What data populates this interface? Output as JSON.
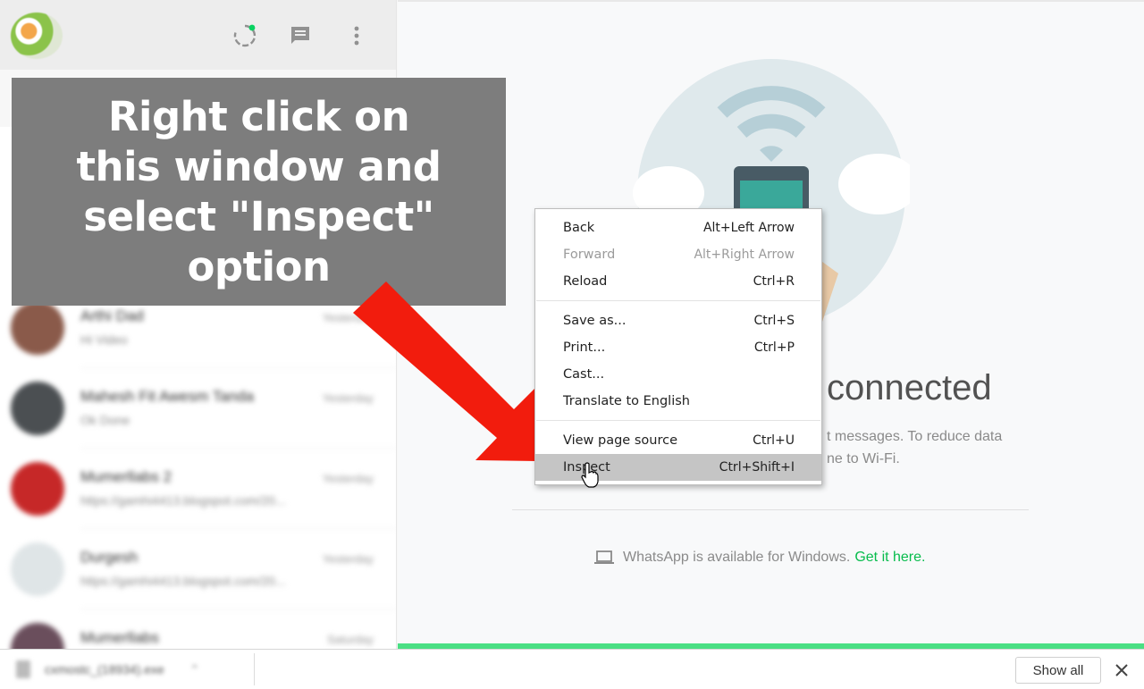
{
  "caption": {
    "line1": "Right click on",
    "line2": "this window and",
    "line3": "select \"Inspect\" option"
  },
  "sidebar": {
    "chats": [
      {
        "name": "Arthi Dad",
        "time": "Yesterday",
        "preview": "Hi Video"
      },
      {
        "name": "Mahesh Fit Awesm Tanda",
        "time": "Yesterday",
        "preview": "Ok Done"
      },
      {
        "name": "Mumerllabs 2",
        "time": "Yesterday",
        "preview": "https://gamhi4413.blogspot.com/20..."
      },
      {
        "name": "Durgesh",
        "time": "Yesterday",
        "preview": "https://gamhi4413.blogspot.com/20..."
      },
      {
        "name": "Mumerllabs",
        "time": "Saturday",
        "preview": ""
      }
    ]
  },
  "main": {
    "heading": "connected",
    "desc1": "t messages. To reduce data",
    "desc2": "ne to Wi-Fi.",
    "windows_text": "WhatsApp is available for Windows.",
    "windows_link": "Get it here."
  },
  "context_menu": {
    "items": [
      {
        "label": "Back",
        "shortcut": "Alt+Left Arrow",
        "disabled": false
      },
      {
        "label": "Forward",
        "shortcut": "Alt+Right Arrow",
        "disabled": true
      },
      {
        "label": "Reload",
        "shortcut": "Ctrl+R",
        "disabled": false
      },
      {
        "label": "Save as...",
        "shortcut": "Ctrl+S",
        "disabled": false
      },
      {
        "label": "Print...",
        "shortcut": "Ctrl+P",
        "disabled": false
      },
      {
        "label": "Cast...",
        "shortcut": "",
        "disabled": false
      },
      {
        "label": "Translate to English",
        "shortcut": "",
        "disabled": false
      },
      {
        "label": "View page source",
        "shortcut": "Ctrl+U",
        "disabled": false
      },
      {
        "label": "Inspect",
        "shortcut": "Ctrl+Shift+I",
        "disabled": false,
        "highlighted": true
      }
    ]
  },
  "downloads": {
    "file_name": "cxmostc_(18934).exe",
    "show_all": "Show all",
    "close_symbol": "✕"
  },
  "icons": {
    "header": [
      "status-icon",
      "chat-icon",
      "menu-icon"
    ],
    "annotation": "red-arrow-icon"
  },
  "colors": {
    "accent_green": "#07bc4c",
    "progress_green": "#4adf83",
    "caption_bg": "#7d7d7d",
    "arrow_red": "#f21c0d",
    "menu_highlight": "#c5c5c5"
  }
}
